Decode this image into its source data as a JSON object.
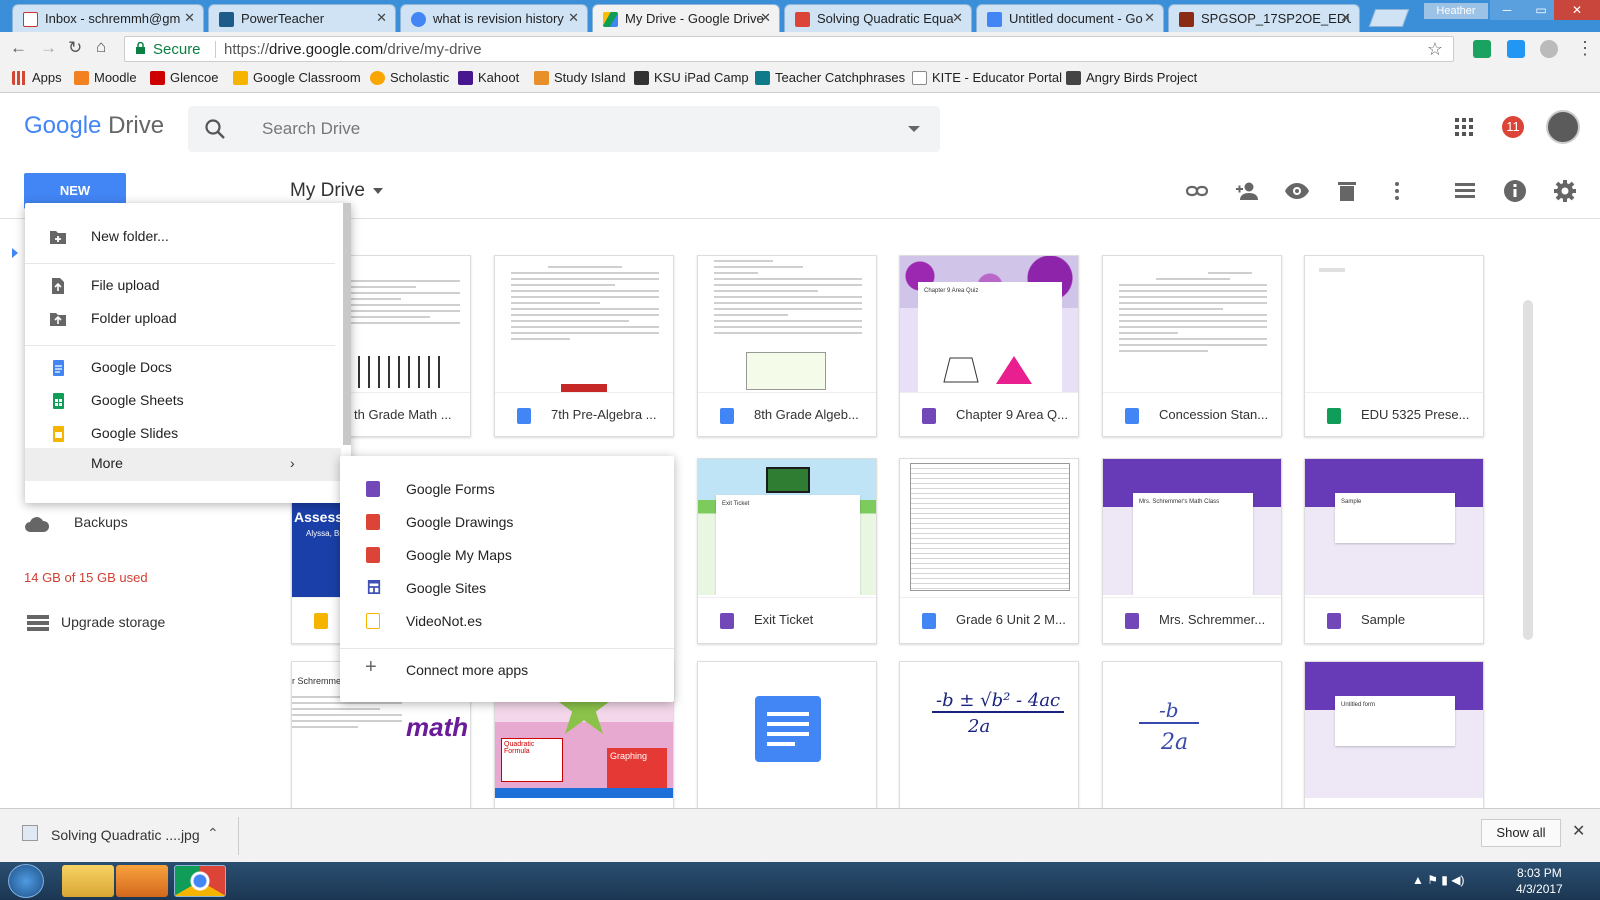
{
  "browser": {
    "tabs": [
      {
        "title": "Inbox - schremmh@gm",
        "color": "#ffffff",
        "active": false
      },
      {
        "title": "PowerTeacher",
        "color": "#1d5c8a",
        "active": false
      },
      {
        "title": "what is revision history",
        "color": "#4285f4",
        "active": false
      },
      {
        "title": "My Drive - Google Drive",
        "color": "#fbbc04",
        "active": true
      },
      {
        "title": "Solving Quadratic Equa",
        "color": "#db4437",
        "active": false
      },
      {
        "title": "Untitled document - Go",
        "color": "#4285f4",
        "active": false
      },
      {
        "title": "SPGSOP_17SP2OE_EDU",
        "color": "#8a2b13",
        "active": false
      }
    ],
    "user": "Heather",
    "secure_label": "Secure",
    "url_prefix": "https://",
    "url_host": "drive.google.com",
    "url_path": "/drive/my-drive",
    "bookmarks": [
      {
        "label": "Apps",
        "color": "#d14836"
      },
      {
        "label": "Moodle",
        "color": "#f48120"
      },
      {
        "label": "Glencoe",
        "color": "#cc0000"
      },
      {
        "label": "Google Classroom",
        "color": "#f4b400"
      },
      {
        "label": "Scholastic",
        "color": "#f9a602"
      },
      {
        "label": "Kahoot",
        "color": "#46178f"
      },
      {
        "label": "Study Island",
        "color": "#e88f2a"
      },
      {
        "label": "KSU iPad Camp",
        "color": "#333333"
      },
      {
        "label": "Teacher Catchphrases",
        "color": "#0f7a8a"
      },
      {
        "label": "KITE - Educator Portal",
        "color": "#888888"
      },
      {
        "label": "Angry Birds Project",
        "color": "#444444"
      }
    ]
  },
  "drive": {
    "logo_google": "Google",
    "logo_drive": "Drive",
    "search_placeholder": "Search Drive",
    "notifications": "11",
    "new_label": "NEW",
    "title": "My Drive",
    "sidebar": {
      "backups": "Backups",
      "storage": "14 GB of 15 GB used",
      "upgrade": "Upgrade storage"
    },
    "new_menu": [
      {
        "label": "New folder...",
        "icon": "folder-plus-icon"
      },
      {
        "label": "File upload",
        "icon": "file-upload-icon"
      },
      {
        "label": "Folder upload",
        "icon": "folder-upload-icon"
      },
      {
        "label": "Google Docs",
        "icon": "docs-icon",
        "color": "#4285f4"
      },
      {
        "label": "Google Sheets",
        "icon": "sheets-icon",
        "color": "#0f9d58"
      },
      {
        "label": "Google Slides",
        "icon": "slides-icon",
        "color": "#f4b400"
      },
      {
        "label": "More",
        "icon": "chevron-right-icon"
      }
    ],
    "more_menu": [
      {
        "label": "Google Forms",
        "color": "#7248b9"
      },
      {
        "label": "Google Drawings",
        "color": "#db4437"
      },
      {
        "label": "Google My Maps",
        "color": "#db4437"
      },
      {
        "label": "Google Sites",
        "color": "#3f51b5"
      },
      {
        "label": "VideoNot.es",
        "color": "#f4b400"
      },
      {
        "label": "Connect more apps",
        "color": "#666666"
      }
    ],
    "files_row1": [
      {
        "name": "th Grade Math ...",
        "icon_color": "#4285f4"
      },
      {
        "name": "7th Pre-Algebra ...",
        "icon_color": "#4285f4"
      },
      {
        "name": "8th Grade Algeb...",
        "icon_color": "#4285f4"
      },
      {
        "name": "Chapter 9 Area Q...",
        "icon_color": "#7248b9"
      },
      {
        "name": "Concession Stan...",
        "icon_color": "#4285f4"
      },
      {
        "name": "EDU 5325 Prese...",
        "icon_color": "#0f9d58"
      }
    ],
    "files_row2": [
      {
        "name": "Exit Ticket",
        "icon_color": "#7248b9"
      },
      {
        "name": "Grade 6 Unit 2 M...",
        "icon_color": "#4285f4"
      },
      {
        "name": "Mrs. Schremmer...",
        "icon_color": "#7248b9"
      },
      {
        "name": "Sample",
        "icon_color": "#7248b9"
      }
    ],
    "partial_card_title": "Assess",
    "partial_card_sub": "Alyssa, Bra",
    "thumb_texts": {
      "chapter9": "Chapter 9 Area Quiz",
      "exit": "Exit Ticket",
      "mrs": "Mrs. Schremmer's Math Class",
      "sample": "Sample",
      "untitled_form": "Untitled form",
      "quadratic": "Quadratic Formula",
      "graphing": "Graphing",
      "math": "math",
      "formula1": "-b ± √b² - 4ac",
      "formula1_den": "2a",
      "formula2": "-b",
      "formula2_den": "2a",
      "schremm": "r Schremme"
    }
  },
  "download": {
    "file": "Solving Quadratic ....jpg",
    "show_all": "Show all"
  },
  "taskbar": {
    "time": "8:03 PM",
    "date": "4/3/2017"
  }
}
